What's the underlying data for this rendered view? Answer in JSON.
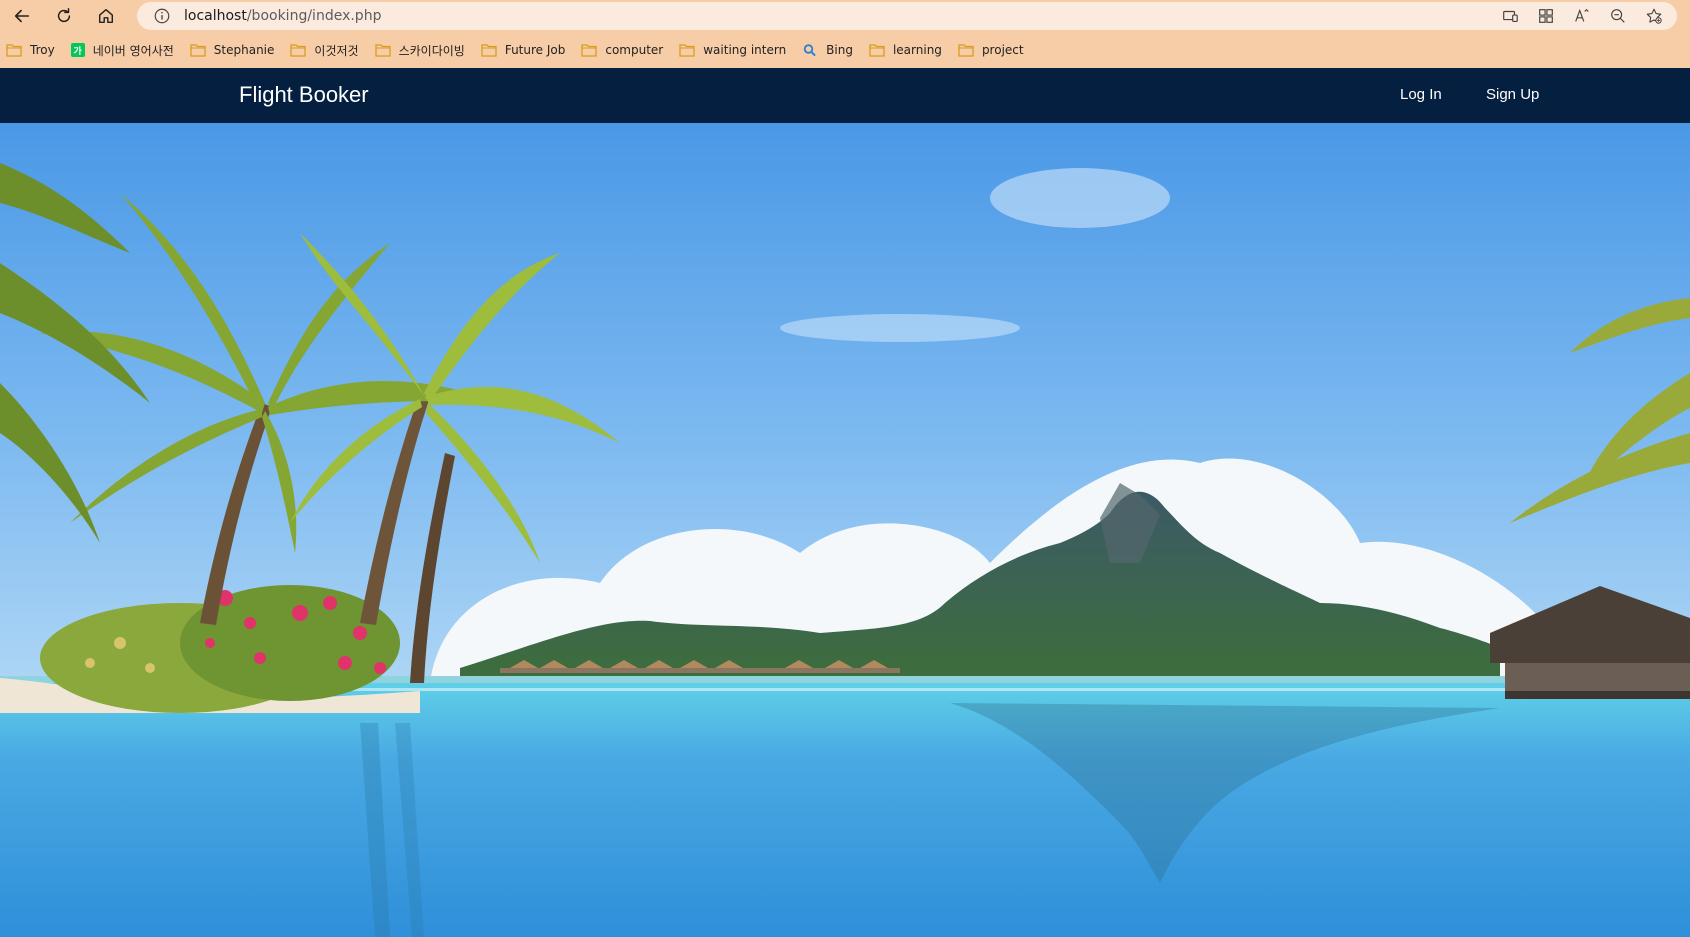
{
  "browser": {
    "url_host": "localhost",
    "url_path": "/booking/index.php",
    "nav_icons": [
      "back-arrow-icon",
      "refresh-icon",
      "home-icon"
    ],
    "address_icons": [
      "site-info-icon",
      "app-available-icon",
      "extensions-icon",
      "read-aloud-icon",
      "zoom-out-icon",
      "add-favorite-icon"
    ]
  },
  "bookmarks": [
    {
      "label": "Troy",
      "icon": "folder-icon"
    },
    {
      "label": "네이버 영어사전",
      "icon": "naver-icon",
      "badge": "가"
    },
    {
      "label": "Stephanie",
      "icon": "folder-icon"
    },
    {
      "label": "이것저것",
      "icon": "folder-icon"
    },
    {
      "label": "스카이다이빙",
      "icon": "folder-icon"
    },
    {
      "label": "Future Job",
      "icon": "folder-icon"
    },
    {
      "label": "computer",
      "icon": "folder-icon"
    },
    {
      "label": "waiting intern",
      "icon": "folder-icon"
    },
    {
      "label": "Bing",
      "icon": "bing-search-icon"
    },
    {
      "label": "learning",
      "icon": "folder-icon"
    },
    {
      "label": "project",
      "icon": "folder-icon"
    }
  ],
  "site": {
    "brand": "Flight Booker",
    "nav": {
      "login": "Log In",
      "signup": "Sign Up"
    }
  },
  "colors": {
    "browser_chrome": "#f7cda8",
    "navbar_bg": "#041f3f",
    "navbar_text": "#ffffff",
    "folder_icon": "#e8b441"
  }
}
